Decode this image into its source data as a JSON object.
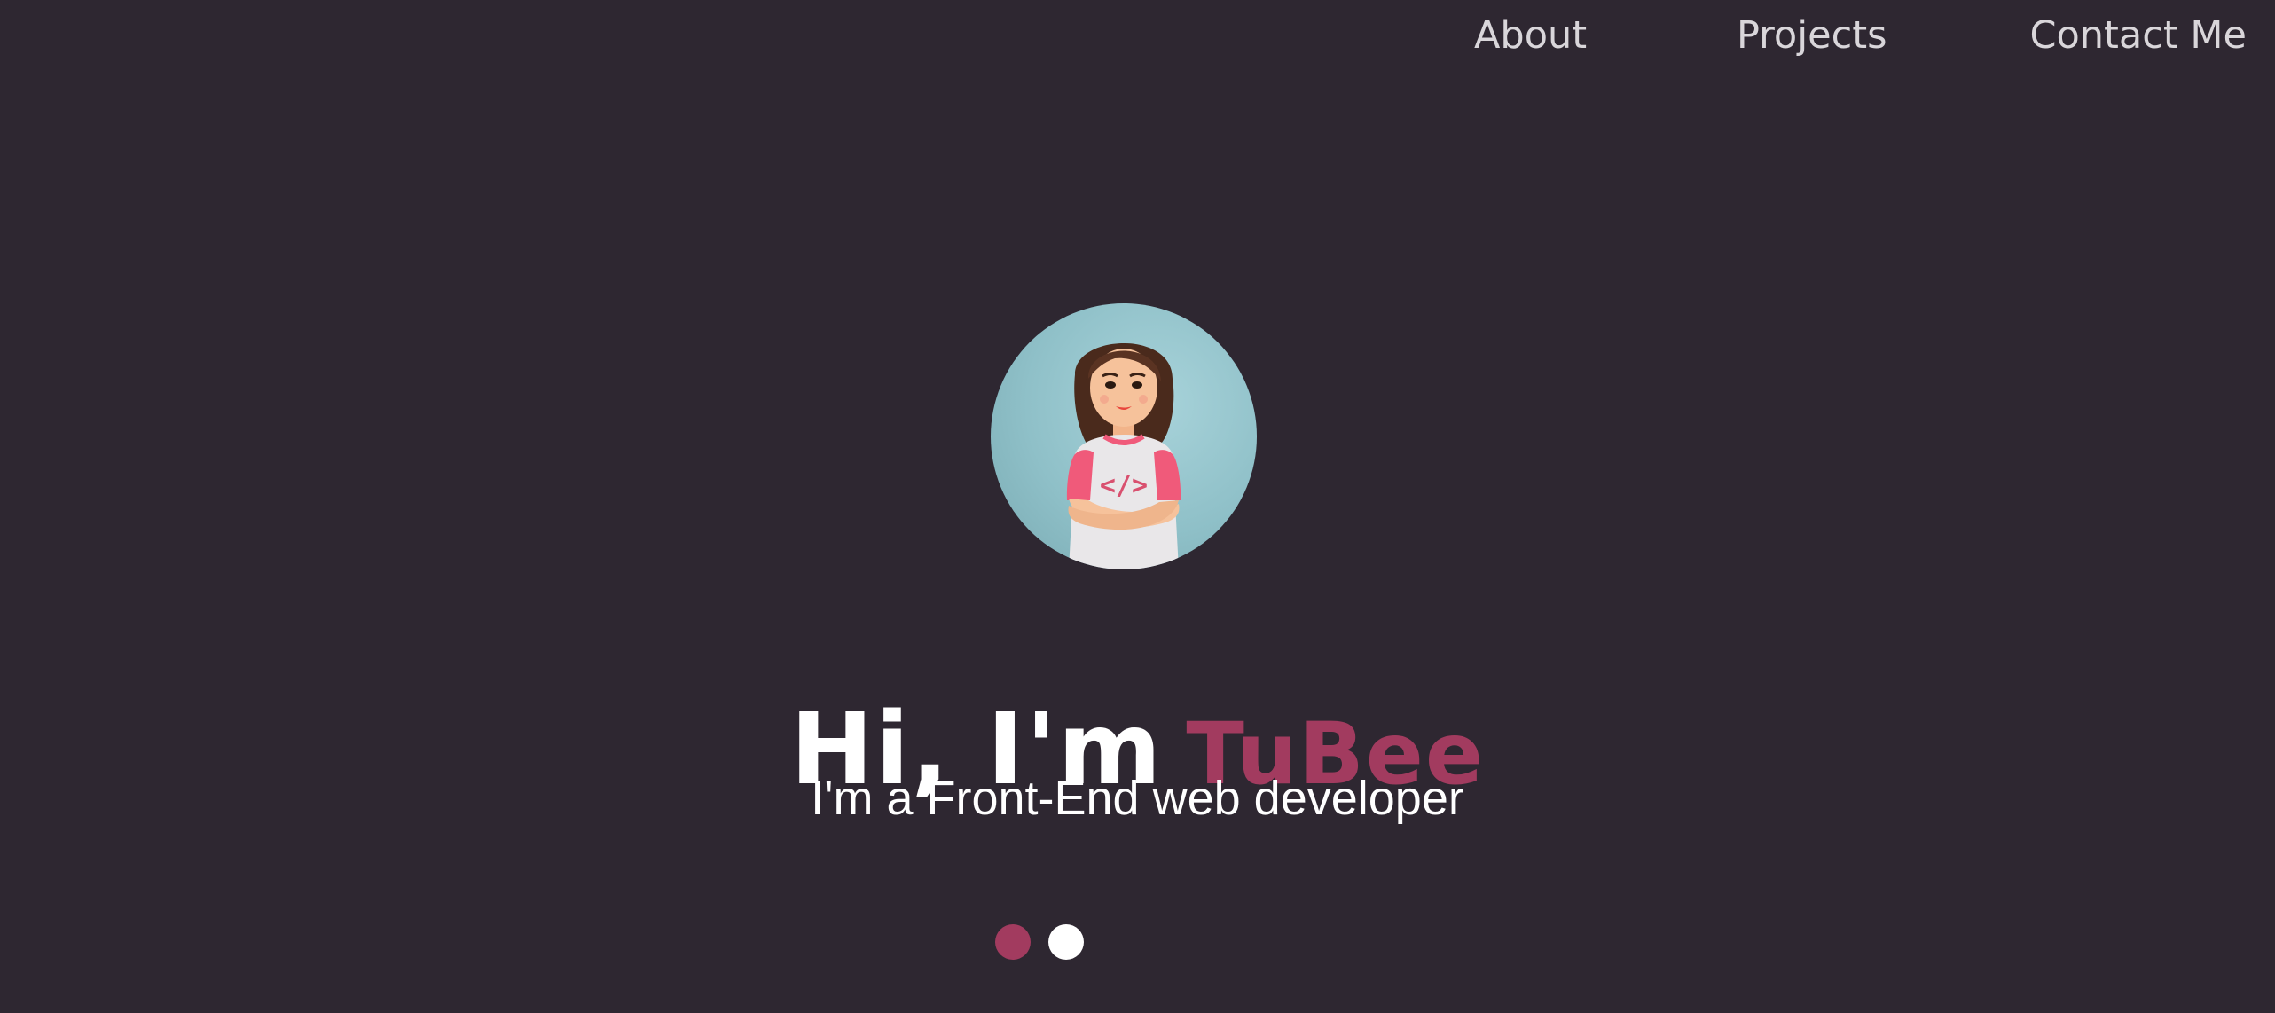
{
  "nav": {
    "items": [
      {
        "label": "About"
      },
      {
        "label": "Projects"
      },
      {
        "label": "Contact Me"
      }
    ]
  },
  "hero": {
    "greeting": "Hi, I'm",
    "name": "TuBee",
    "subtitle": "I'm a Front-End web developer",
    "avatar_icon": "developer-avatar-icon",
    "shirt_text": "</>"
  },
  "carousel": {
    "dots": [
      {
        "state": "active",
        "color": "#a23b5f"
      },
      {
        "state": "inactive",
        "color": "#ffffff"
      }
    ]
  },
  "colors": {
    "background": "#2e2731",
    "accent": "#a23b5f",
    "nav_text": "#d9d6da",
    "text": "#ffffff"
  }
}
